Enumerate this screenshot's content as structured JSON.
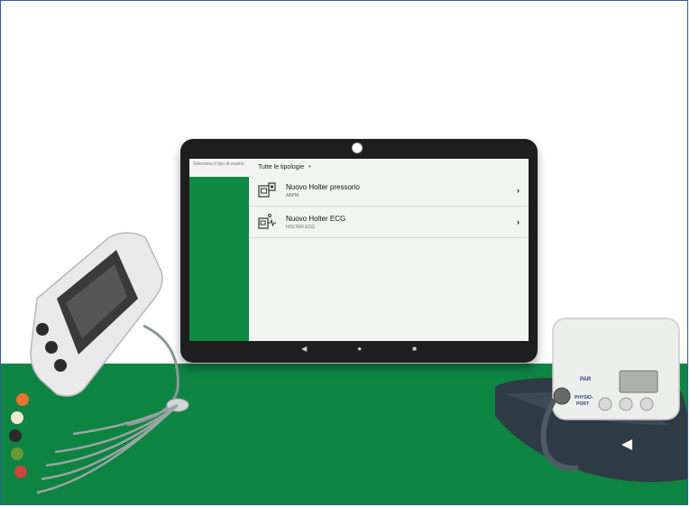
{
  "tablet": {
    "sidebar": {
      "header": "Seleziona il tipo di esame"
    },
    "filter": {
      "label": "Tutte le tipologie",
      "caret": "▾"
    },
    "items": [
      {
        "title": "Nuovo Holter pressorio",
        "subtitle": "ABPM",
        "icon": "pressure-holter-icon"
      },
      {
        "title": "Nuovo Holter ECG",
        "subtitle": "HOLTER ECG",
        "icon": "ecg-holter-icon"
      }
    ],
    "chevron": "›",
    "nav": {
      "back": "◀",
      "home": "●",
      "recents": "■"
    }
  },
  "abpm_device": {
    "brand": "PAR",
    "model_line1": "PHYSIO-",
    "model_line2": "PORT"
  },
  "colors": {
    "brand_green": "#0e8443",
    "frame": "#2d5f9a"
  }
}
